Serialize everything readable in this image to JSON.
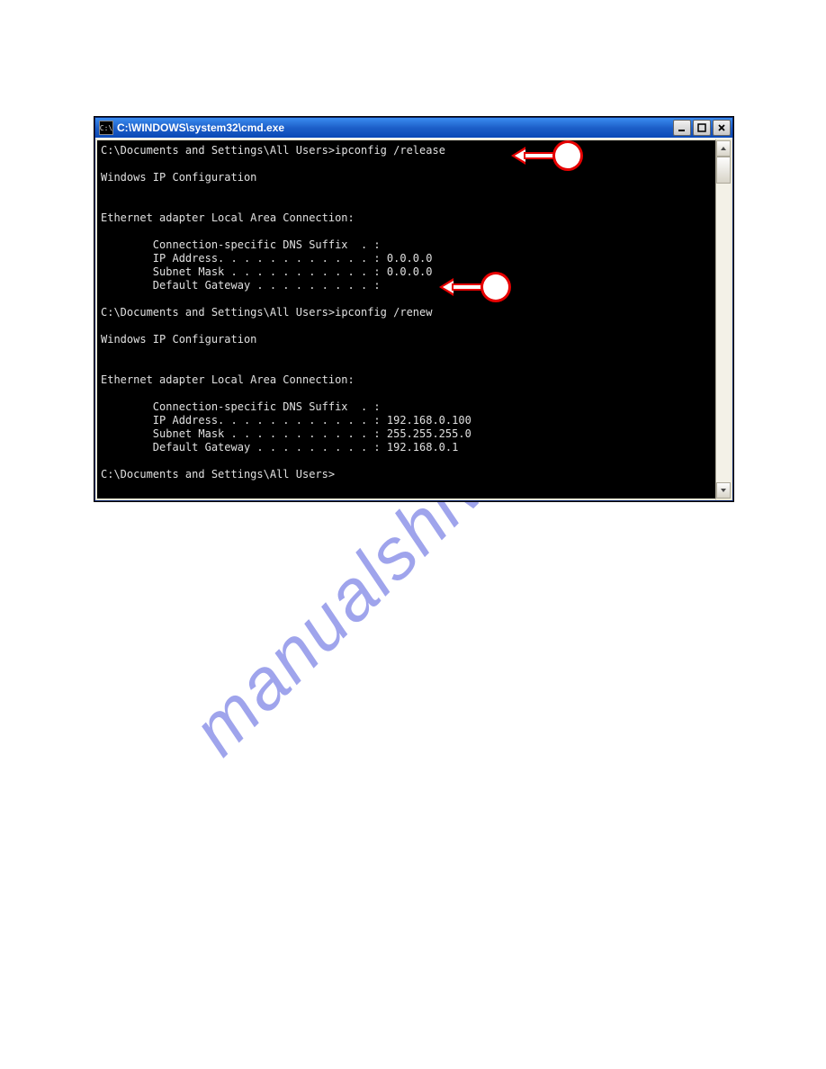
{
  "watermark": "manualshive.com",
  "window": {
    "title_icon": "C:\\",
    "title": "C:\\WINDOWS\\system32\\cmd.exe"
  },
  "console": {
    "prompt1": "C:\\Documents and Settings\\All Users>",
    "cmd1": "ipconfig /release",
    "hdr1": "Windows IP Configuration",
    "adapter1_hdr": "Ethernet adapter Local Area Connection:",
    "adapter1_dns": "        Connection-specific DNS Suffix  . :",
    "adapter1_ip": "        IP Address. . . . . . . . . . . . : 0.0.0.0",
    "adapter1_mask": "        Subnet Mask . . . . . . . . . . . : 0.0.0.0",
    "adapter1_gw": "        Default Gateway . . . . . . . . . :",
    "prompt2": "C:\\Documents and Settings\\All Users>",
    "cmd2": "ipconfig /renew",
    "hdr2": "Windows IP Configuration",
    "adapter2_hdr": "Ethernet adapter Local Area Connection:",
    "adapter2_dns": "        Connection-specific DNS Suffix  . :",
    "adapter2_ip": "        IP Address. . . . . . . . . . . . : 192.168.0.100",
    "adapter2_mask": "        Subnet Mask . . . . . . . . . . . : 255.255.255.0",
    "adapter2_gw": "        Default Gateway . . . . . . . . . : 192.168.0.1",
    "prompt3": "C:\\Documents and Settings\\All Users>"
  },
  "callouts": {
    "c1": "callout-release",
    "c2": "callout-renew"
  }
}
